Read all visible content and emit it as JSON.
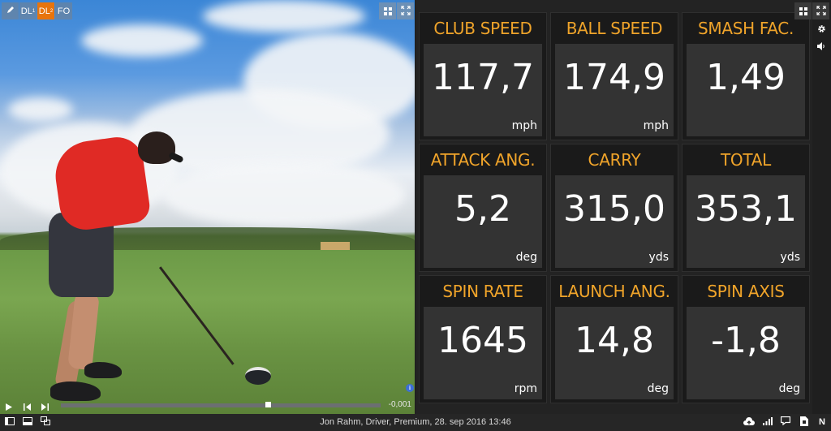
{
  "video": {
    "toolbar": {
      "draw_tool": "pencil-icon",
      "views": [
        {
          "label": "DL",
          "sub": "1",
          "active": false
        },
        {
          "label": "DL",
          "sub": "2",
          "active": true
        },
        {
          "label": "FO",
          "sub": "",
          "active": false
        }
      ],
      "layout_icon": "grid-icon",
      "fullscreen_icon": "fullscreen-icon"
    },
    "info_icon": "i",
    "playback": {
      "play_icon": "play-icon",
      "prev_icon": "step-back-icon",
      "next_icon": "step-forward-icon",
      "position_fraction": 0.65,
      "time": "-0,001"
    }
  },
  "metrics": {
    "accent_color": "#f0a42a",
    "tiles": [
      {
        "title": "CLUB SPEED",
        "value": "117,7",
        "unit": "mph"
      },
      {
        "title": "BALL SPEED",
        "value": "174,9",
        "unit": "mph"
      },
      {
        "title": "SMASH FAC.",
        "value": "1,49",
        "unit": ""
      },
      {
        "title": "ATTACK ANG.",
        "value": "5,2",
        "unit": "deg"
      },
      {
        "title": "CARRY",
        "value": "315,0",
        "unit": "yds"
      },
      {
        "title": "TOTAL",
        "value": "353,1",
        "unit": "yds"
      },
      {
        "title": "SPIN RATE",
        "value": "1645",
        "unit": "rpm"
      },
      {
        "title": "LAUNCH ANG.",
        "value": "14,8",
        "unit": "deg"
      },
      {
        "title": "SPIN AXIS",
        "value": "-1,8",
        "unit": "deg"
      }
    ]
  },
  "side": {
    "icons": [
      "grid-icon",
      "fullscreen-icon",
      "gear-icon",
      "speaker-icon"
    ]
  },
  "statusbar": {
    "session_text": "Jon Rahm, Driver, Premium, 28. sep 2016 13:46",
    "left_icons": [
      "panel-left-icon",
      "panel-bottom-icon",
      "copy-windows-icon"
    ],
    "right_icons": [
      "cloud-upload-icon",
      "signal-bars-icon",
      "chat-icon",
      "document-icon"
    ],
    "mode_letter": "N"
  }
}
